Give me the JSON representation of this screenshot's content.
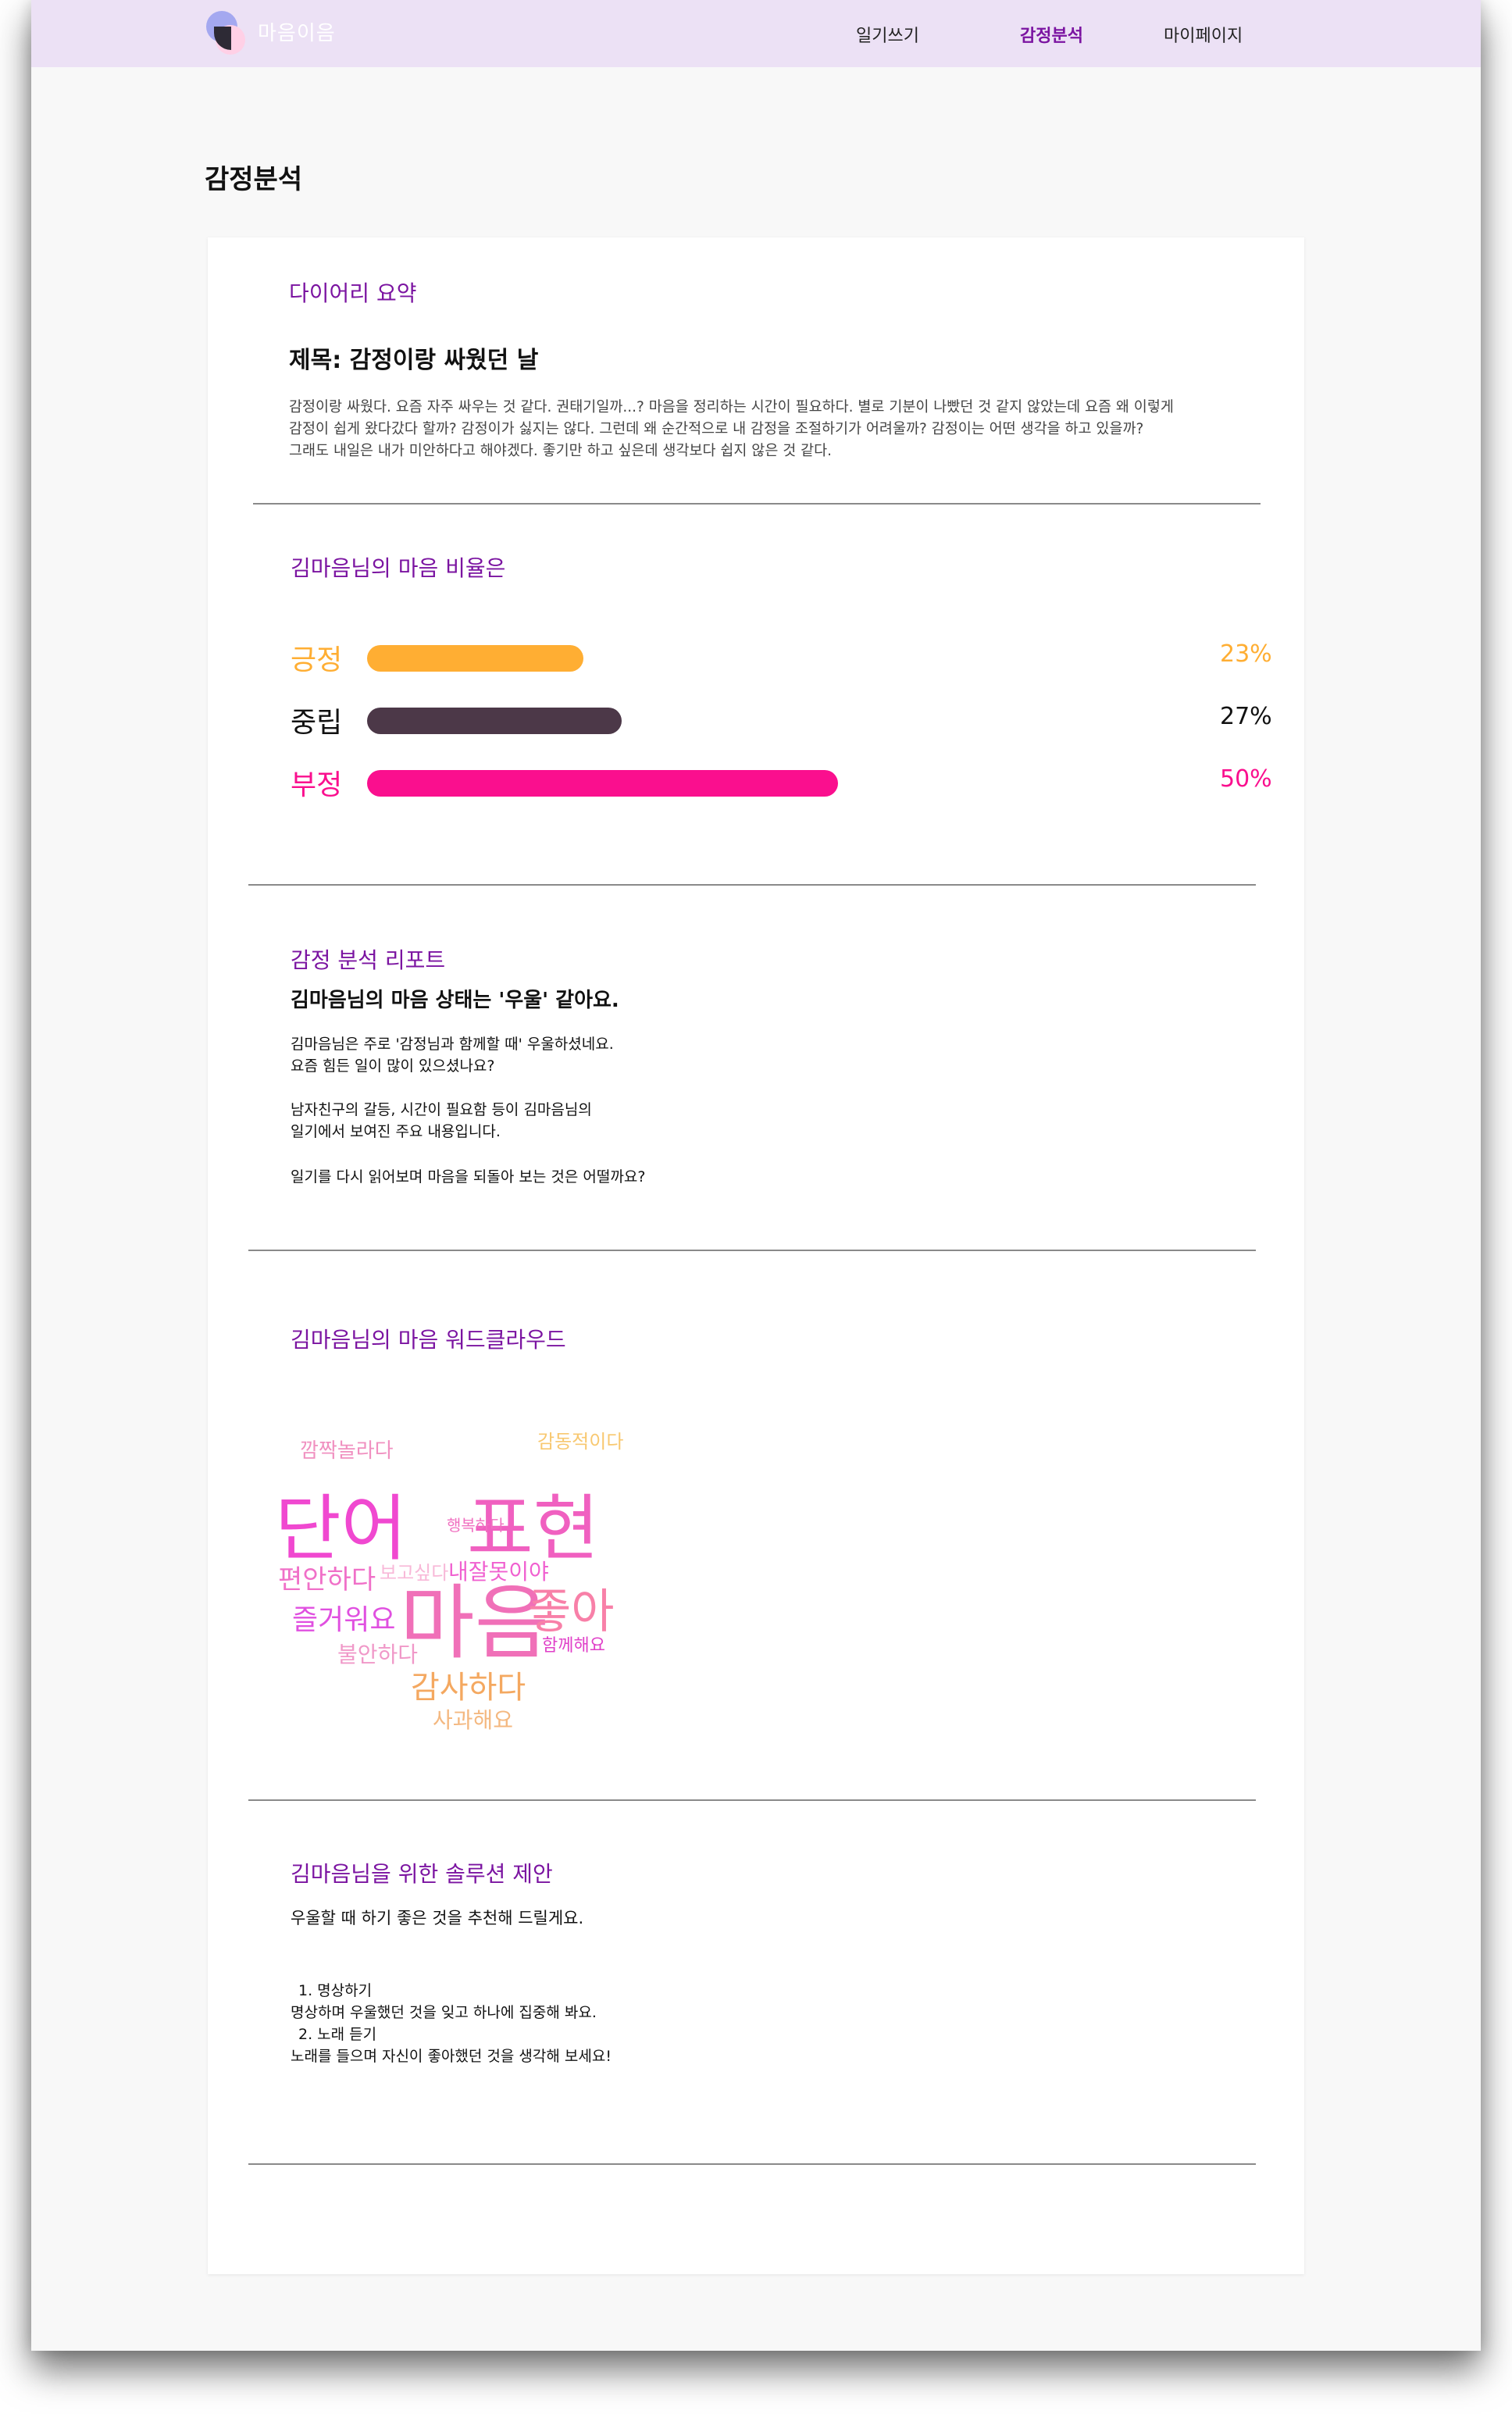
{
  "nav": {
    "brand": "마음이음",
    "items": [
      "일기쓰기",
      "감정분석",
      "마이페이지"
    ],
    "active": "감정분석"
  },
  "page_title": "감정분석",
  "summary": {
    "section_title": "다이어리 요약",
    "title": "제목: 감정이랑 싸웠던 날",
    "lines": [
      "감정이랑 싸웠다. 요즘 자주 싸우는 것 같다. 권태기일까...? 마음을 정리하는 시간이 필요하다. 별로 기분이 나빴던 것 같지 않았는데 요즘 왜 이렇게",
      "감정이 쉽게 왔다갔다 할까? 감정이가 싫지는 않다. 그런데 왜 순간적으로 내 감정을 조절하기가 어려울까? 감정이는 어떤 생각을 하고 있을까?",
      "그래도 내일은 내가 미안하다고 해야겠다. 좋기만 하고 싶은데 생각보다 쉽지 않은 것 같다."
    ]
  },
  "ratio": {
    "section_title": "김마음님의 마음 비율은",
    "items": [
      {
        "label": "긍정",
        "value": 23,
        "pct": "23%",
        "color": "#ffae33"
      },
      {
        "label": "중립",
        "value": 27,
        "pct": "27%",
        "color": "#4c3848"
      },
      {
        "label": "부정",
        "value": 50,
        "pct": "50%",
        "color": "#fa0f8e"
      }
    ]
  },
  "report": {
    "section_title": "감정 분석 리포트",
    "headline": "김마음님의 마음 상태는 '우울' 같아요.",
    "lines": [
      "김마음님은 주로 '감정님과 함께할 때' 우울하셨네요.",
      "요즘 힘든 일이 많이 있으셨나요?",
      "",
      "남자친구의 갈등, 시간이 필요함 등이 김마음님의",
      "일기에서 보여진 주요 내용입니다.",
      "",
      "일기를 다시 읽어보며 마음을 되돌아 보는 것은 어떨까요?"
    ]
  },
  "wordcloud": {
    "section_title": "김마음님의 마음 워드클라우드",
    "words": [
      {
        "text": "단어",
        "color": "#f048d0"
      },
      {
        "text": "표현",
        "color": "#f060c0"
      },
      {
        "text": "마음",
        "color": "#f070b8"
      },
      {
        "text": "좋아",
        "color": "#f880a8"
      },
      {
        "text": "감사하다",
        "color": "#f4a860"
      },
      {
        "text": "편안하다",
        "color": "#f070c8"
      },
      {
        "text": "즐거워요",
        "color": "#e050e0"
      },
      {
        "text": "깜짝놀라다",
        "color": "#f090c0"
      },
      {
        "text": "내잘못이야",
        "color": "#f060d0"
      },
      {
        "text": "불안하다",
        "color": "#f098c8"
      },
      {
        "text": "사과해요",
        "color": "#f4b880"
      },
      {
        "text": "감동적이다",
        "color": "#f8c870"
      },
      {
        "text": "함께해요",
        "color": "#e040c8"
      },
      {
        "text": "보고싶다",
        "color": "#f8b8d8"
      },
      {
        "text": "행복하다",
        "color": "#f070c0"
      }
    ]
  },
  "solution": {
    "section_title": "김마음님을 위한 솔루션 제안",
    "intro": "우울할 때 하기 좋은 것을 추천해 드릴게요.",
    "lines": [
      "1. 명상하기",
      "명상하며 우울했던 것을 잊고 하나에 집중해 봐요.",
      "2. 노래 듣기",
      "노래를 들으며 자신이 좋아했던 것을 생각해 보세요!"
    ]
  }
}
